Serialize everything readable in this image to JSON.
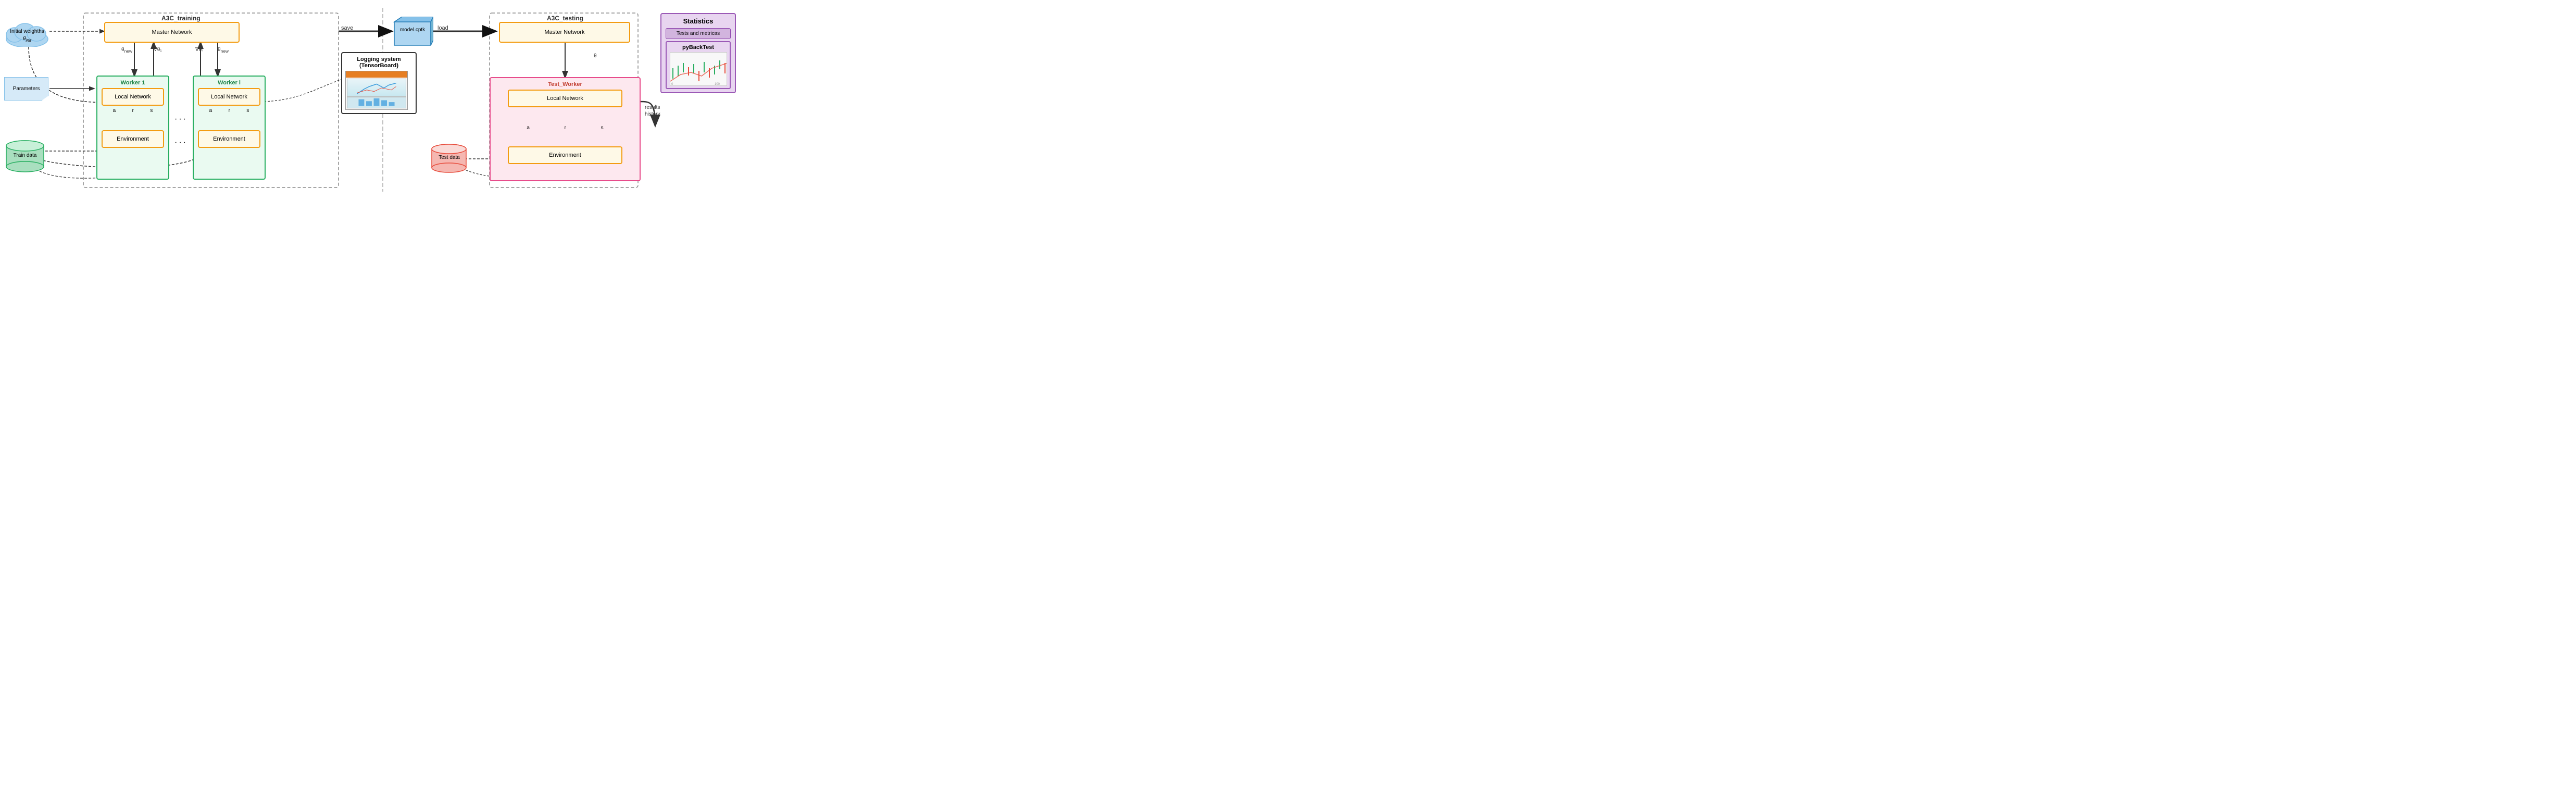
{
  "diagram": {
    "title_training": "A3C_training",
    "title_testing": "A3C_testing",
    "nodes": {
      "initial_weights": {
        "label": "Initial weighths",
        "sub": "θ_init"
      },
      "parameters": {
        "label": "Parameters"
      },
      "train_data": {
        "label": "Train data"
      },
      "master_network_left": {
        "label": "Master Network"
      },
      "worker1": {
        "label": "Worker 1"
      },
      "worker_i": {
        "label": "Worker i"
      },
      "local_network_1": {
        "label": "Local Network"
      },
      "local_network_i": {
        "label": "Local Network"
      },
      "environment_1": {
        "label": "Environment"
      },
      "environment_i": {
        "label": "Environment"
      },
      "model_cptk": {
        "label": "model.cptk"
      },
      "logging_system": {
        "label": "Logging system\n(TensorBoard)"
      },
      "master_network_right": {
        "label": "Master Network"
      },
      "test_worker": {
        "label": "Test_Worker"
      },
      "local_network_test": {
        "label": "Local Network"
      },
      "environment_test": {
        "label": "Environment"
      },
      "test_data": {
        "label": "Test data"
      },
      "statistics": {
        "label": "Statistics"
      },
      "tests_metrics": {
        "label": "Tests and metricas"
      },
      "pybacktest": {
        "label": "pyBackTest"
      }
    },
    "arrows": {
      "save_label": "save",
      "load_label": "load",
      "theta_new": "θ_new",
      "theta_new2": "θ_new",
      "grad_theta1": "∇θ₁",
      "grad_thetai": "∇θᵢ",
      "theta": "θ",
      "results_history": "results\nhistory",
      "a": "a",
      "r": "r",
      "s": "s"
    }
  }
}
